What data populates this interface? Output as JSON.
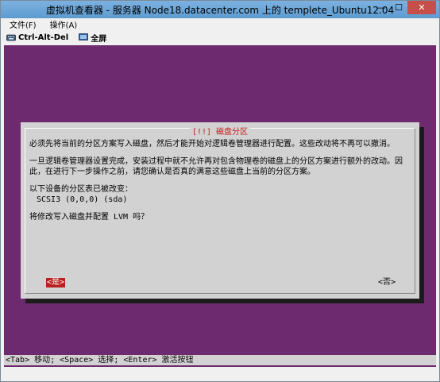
{
  "window": {
    "title": "虚拟机查看器 - 服务器 Node18.datacenter.com 上的 templete_Ubuntu12.04",
    "minimize_glyph": "—",
    "maximize_glyph": "☐",
    "close_glyph": "✕"
  },
  "menu": {
    "items": [
      {
        "label": "文件(F)"
      },
      {
        "label": "操作(A)"
      }
    ]
  },
  "toolbar": {
    "ctrl_alt_del_label": "Ctrl-Alt-Del",
    "fullscreen_label": "全屏"
  },
  "dialog": {
    "title": "[!!] 磁盘分区",
    "para1": "必须先将当前的分区方案写入磁盘，然后才能开始对逻辑卷管理器进行配置。这些改动将不再可以撤消。",
    "para2": "一旦逻辑卷管理器设置完成，安装过程中就不允许再对包含物理卷的磁盘上的分区方案进行额外的改动。因此，在进行下一步操作之前，请您确认是否真的满意这些磁盘上当前的分区方案。",
    "para3": "以下设备的分区表已被改变：",
    "device": "SCSI3 (0,0,0) (sda)",
    "question": "将修改写入磁盘并配置 LVM 吗？",
    "yes_label": "<是>",
    "no_label": "<否>"
  },
  "statusbar": {
    "text": "<Tab> 移动; <Space> 选择; <Enter> 激活按钮"
  },
  "colors": {
    "screen_bg": "#6e2a6e",
    "dialog_bg": "#d2d2d2",
    "title_red": "#c0201b",
    "button_red": "#bb1f1f"
  }
}
